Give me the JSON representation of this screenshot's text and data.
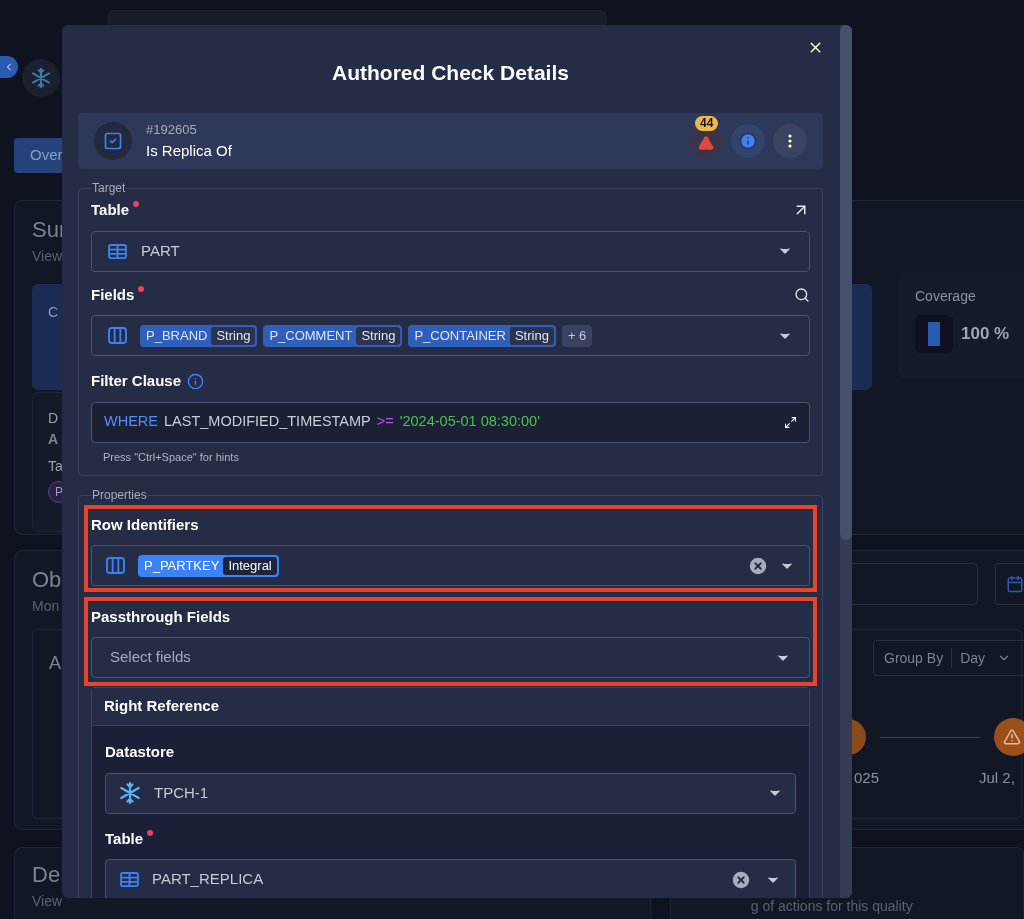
{
  "background": {
    "nav_tab": "Over",
    "summary": {
      "title": "Sur",
      "subtitle": "View",
      "card_label": "C",
      "details": {
        "label": "D",
        "value": "A",
        "tags_label": "Ta",
        "tag": "P"
      },
      "coverage": {
        "label": "Coverage",
        "value": "100 %"
      }
    },
    "observability": {
      "title": "Ob",
      "subtitle": "Mon",
      "card_title": "A",
      "group_by": {
        "label": "Group By",
        "value": "Day"
      },
      "timeline": [
        "025",
        "Jul 2,"
      ]
    },
    "definition": {
      "title": "De",
      "subtitle": "View",
      "note": "g of actions for this quality"
    }
  },
  "modal": {
    "title": "Authored Check Details",
    "check": {
      "id": "#192605",
      "name": "Is Replica Of",
      "alert_count": "44"
    },
    "target": {
      "legend": "Target",
      "table": {
        "label": "Table",
        "required": true,
        "value": "PART"
      },
      "fields": {
        "label": "Fields",
        "required": true,
        "chips": [
          {
            "name": "P_BRAND",
            "type": "String"
          },
          {
            "name": "P_COMMENT",
            "type": "String"
          },
          {
            "name": "P_CONTAINER",
            "type": "String"
          }
        ],
        "more": "+ 6"
      },
      "filter": {
        "label": "Filter Clause",
        "tokens": [
          {
            "kind": "keyword",
            "text": "WHERE"
          },
          {
            "kind": "identifier",
            "text": "LAST_MODIFIED_TIMESTAMP"
          },
          {
            "kind": "operator",
            "text": ">="
          },
          {
            "kind": "string",
            "text": "'2024-05-01 08:30:00'"
          }
        ],
        "hint": "Press \"Ctrl+Space\" for hints"
      }
    },
    "properties": {
      "legend": "Properties",
      "row_identifiers": {
        "label": "Row Identifiers",
        "highlighted": true,
        "chips": [
          {
            "name": "P_PARTKEY",
            "type": "Integral"
          }
        ]
      },
      "passthrough": {
        "label": "Passthrough Fields",
        "highlighted": true,
        "placeholder": "Select fields"
      },
      "right_reference": {
        "title": "Right Reference",
        "datastore": {
          "label": "Datastore",
          "value": "TPCH-1"
        },
        "table": {
          "label": "Table",
          "required": true,
          "value": "PART_REPLICA"
        }
      }
    }
  }
}
